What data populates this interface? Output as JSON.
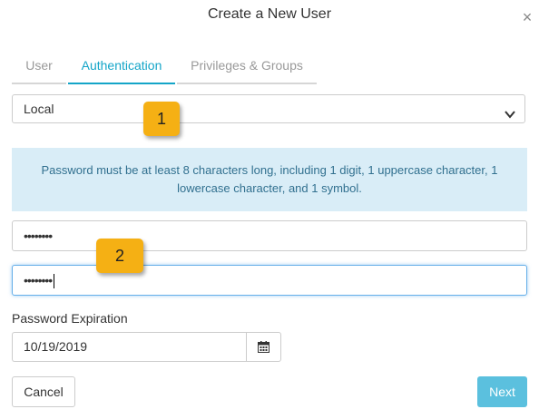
{
  "dialog": {
    "title": "Create a New User",
    "close_icon": "close-icon",
    "close_glyph": "×"
  },
  "tabs": [
    {
      "label": "User",
      "active": false
    },
    {
      "label": "Authentication",
      "active": true
    },
    {
      "label": "Privileges & Groups",
      "active": false
    }
  ],
  "auth_type": {
    "selected": "Local"
  },
  "info": {
    "message": "Password must be at least 8 characters long, including 1 digit, 1 uppercase character, 1 lowercase character, and 1 symbol."
  },
  "password": {
    "value": "••••••••"
  },
  "confirm_password": {
    "value": "••••••••"
  },
  "expiration": {
    "label": "Password Expiration",
    "value": "10/19/2019"
  },
  "buttons": {
    "cancel": "Cancel",
    "next": "Next"
  },
  "callouts": [
    {
      "number": "1"
    },
    {
      "number": "2"
    }
  ],
  "colors": {
    "accent": "#14a5c8",
    "info_bg": "#d9edf7",
    "info_text": "#31708f",
    "next_button": "#5bc0de",
    "callout": "#f5b014"
  }
}
